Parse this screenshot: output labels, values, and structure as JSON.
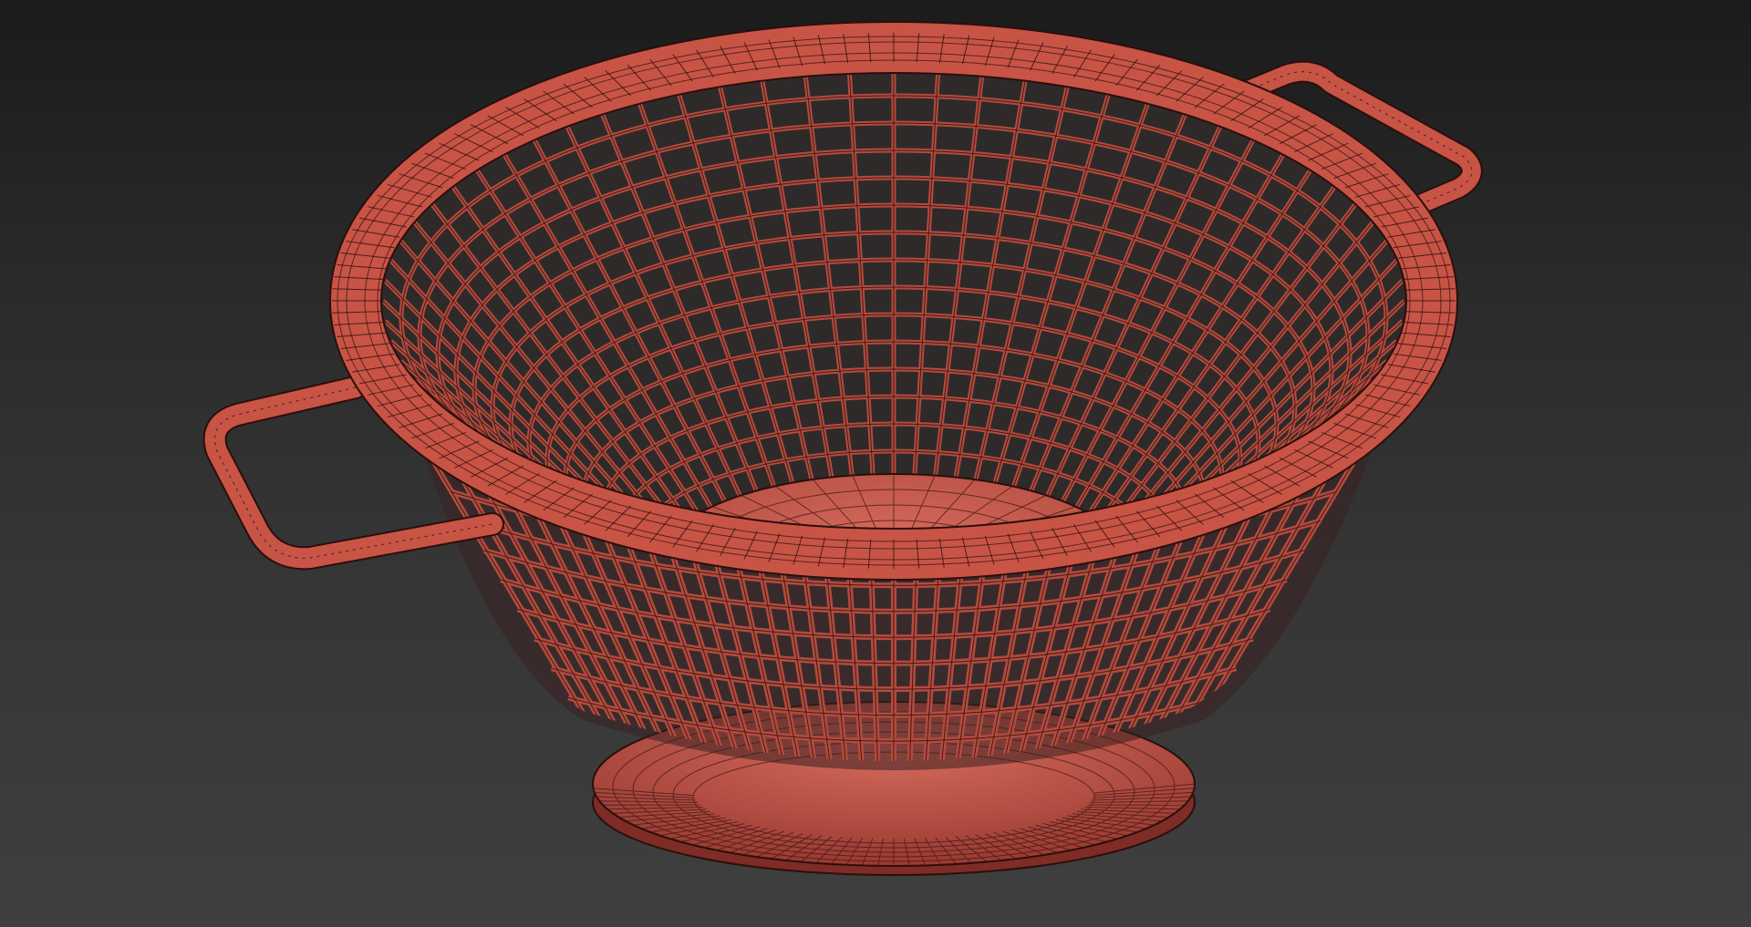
{
  "viewport": {
    "mode": "wireframe-on-shaded",
    "background_colors": {
      "top": "#1b1b1b",
      "bottom": "#3f3f3f"
    }
  },
  "model": {
    "object": "colander",
    "shaded_color": "#c9574a",
    "wire_color": "#2b0f0c",
    "parts": [
      "rim",
      "mesh-bowl",
      "inner-base",
      "foot-ring",
      "left-handle",
      "right-handle"
    ]
  }
}
